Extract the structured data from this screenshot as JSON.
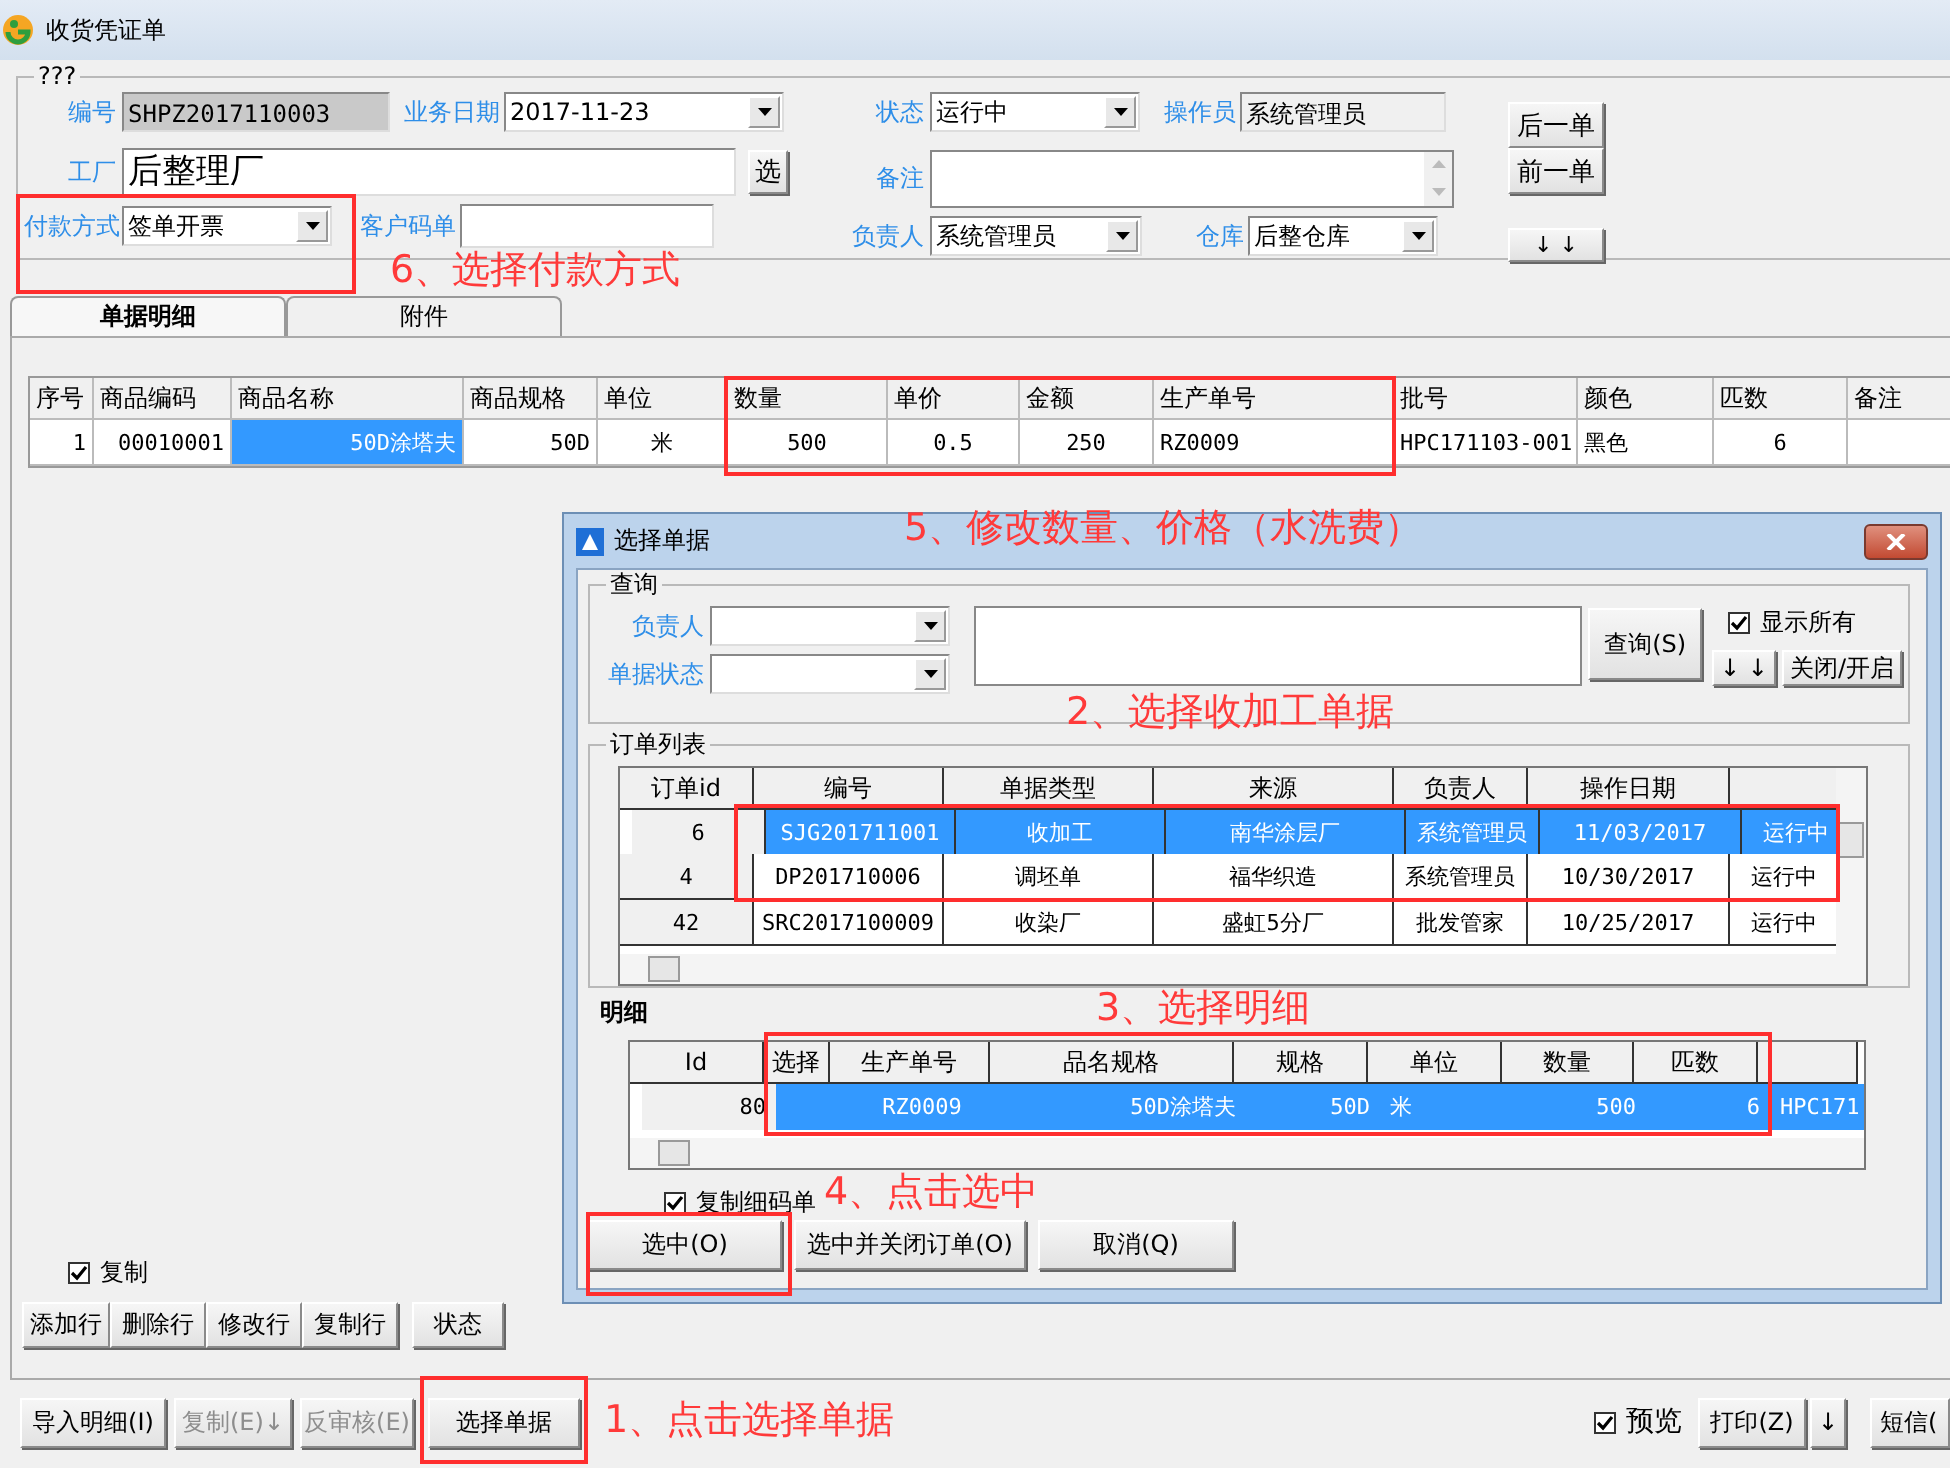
{
  "window": {
    "title": "收货凭证单"
  },
  "header": {
    "group_label": "???",
    "number": {
      "label": "编号",
      "value": "SHPZ2017110003"
    },
    "business_date": {
      "label": "业务日期",
      "value": "2017-11-23"
    },
    "factory": {
      "label": "工厂",
      "value": "后整理厂",
      "button": "选"
    },
    "payment_method": {
      "label": "付款方式",
      "value": "签单开票"
    },
    "customer_code": {
      "label": "客户码单"
    },
    "status": {
      "label": "状态",
      "value": "运行中"
    },
    "operator": {
      "label": "操作员",
      "value": "系统管理员"
    },
    "remark": {
      "label": "备注"
    },
    "person_in_charge": {
      "label": "负责人",
      "value": "系统管理员"
    },
    "warehouse": {
      "label": "仓库",
      "value": "后整仓库"
    },
    "nav_buttons": [
      "后一单",
      "前一单",
      "↓ ↓"
    ]
  },
  "tabs": [
    {
      "label": "单据明细",
      "selected": true
    },
    {
      "label": "附件",
      "selected": false
    }
  ],
  "detail_table": {
    "columns": [
      "序号",
      "商品编码",
      "商品名称",
      "商品规格",
      "单位",
      "数量",
      "单价",
      "金额",
      "生产单号",
      "批号",
      "颜色",
      "匹数",
      "备注"
    ],
    "rows": [
      {
        "cells": [
          {
            "text": "1",
            "selected": false
          },
          {
            "text": "00010001",
            "selected": false
          },
          {
            "text": "50D涂塔夫",
            "selected": true
          },
          {
            "text": "50D",
            "selected": false
          },
          {
            "text": "米",
            "selected": false
          },
          {
            "text": "500",
            "selected": false
          },
          {
            "text": "0.5",
            "selected": false
          },
          {
            "text": "250",
            "selected": false
          },
          {
            "text": "RZ0009",
            "selected": false
          },
          {
            "text": "HPC171103-001",
            "selected": false
          },
          {
            "text": "黑色",
            "selected": false
          },
          {
            "text": "6",
            "selected": false
          },
          {
            "text": null,
            "selected": false
          }
        ]
      }
    ]
  },
  "copy_checkbox": {
    "label": "复制",
    "checked": true
  },
  "row_buttons": [
    "添加行",
    "删除行",
    "修改行",
    "复制行",
    "状态"
  ],
  "bottom_buttons": [
    {
      "label": "导入明细(I)",
      "disabled": false
    },
    {
      "label": "复制(E)↓",
      "disabled": true
    },
    {
      "label": "反审核(E)",
      "disabled": true
    },
    {
      "label": "选择单据",
      "disabled": false
    }
  ],
  "preview_checkbox": {
    "label": "预览",
    "checked": true
  },
  "print_buttons": [
    "打印(Z)",
    "↓",
    "短信("
  ],
  "dialog": {
    "title": "选择单据",
    "query": {
      "group_label": "查询",
      "person_label": "负责人",
      "status_label": "单据状态",
      "search_button": "查询(S)",
      "show_all": {
        "label": "显示所有",
        "checked": true
      },
      "arrows_button": "↓ ↓",
      "toggle_button": "关闭/开启"
    },
    "order_list": {
      "group_label": "订单列表",
      "columns": [
        "订单id",
        "编号",
        "单据类型",
        "来源",
        "负责人",
        "操作日期"
      ],
      "rows": [
        {
          "selected": true,
          "cells": [
            "6",
            "SJG201711001",
            "收加工",
            "南华涂层厂",
            "系统管理员",
            "11/03/2017",
            "运行中"
          ]
        },
        {
          "selected": false,
          "cells": [
            "4",
            "DP201710006",
            "调坯单",
            "福华织造",
            "系统管理员",
            "10/30/2017",
            "运行中"
          ]
        },
        {
          "selected": false,
          "cells": [
            "42",
            "SRC2017100009",
            "收染厂",
            "盛虹5分厂",
            "批发管家",
            "10/25/2017",
            "运行中"
          ]
        }
      ]
    },
    "detail_label": "明细",
    "detail_grid": {
      "columns": [
        "Id",
        "选择",
        "生产单号",
        "品名规格",
        "规格",
        "单位",
        "数量",
        "匹数"
      ],
      "rows": [
        {
          "selected": true,
          "cells": [
            "80",
            null,
            "RZ0009",
            "50D涂塔夫",
            "50D",
            "米",
            "500",
            "6",
            "HPC171"
          ]
        }
      ]
    },
    "copy_detail": {
      "label": "复制细码单",
      "checked": true
    },
    "buttons": [
      "选中(O)",
      "选中并关闭订单(O)",
      "取消(Q)"
    ]
  },
  "annotations": [
    {
      "text": "6、选择付款方式"
    },
    {
      "text": "5、修改数量、价格（水洗费）"
    },
    {
      "text": "2、选择收加工单据"
    },
    {
      "text": "3、选择明细"
    },
    {
      "text": "4、点击选中"
    },
    {
      "text": "1、点击选择单据"
    }
  ]
}
